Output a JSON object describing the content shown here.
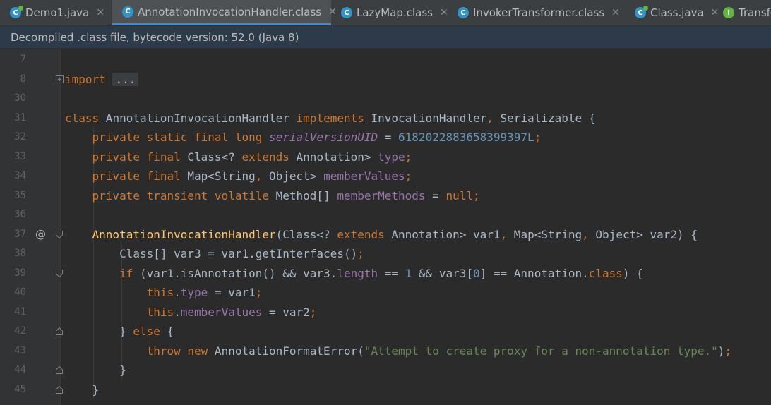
{
  "tabs": [
    {
      "label": "Demo1.java",
      "icon": "java-class-icon",
      "glyph": "C",
      "active": false
    },
    {
      "label": "AnnotationInvocationHandler.class",
      "icon": "class-icon",
      "glyph": "C",
      "active": true
    },
    {
      "label": "LazyMap.class",
      "icon": "class-icon",
      "glyph": "C",
      "active": false
    },
    {
      "label": "InvokerTransformer.class",
      "icon": "class-icon",
      "glyph": "C",
      "active": false
    },
    {
      "label": "Class.java",
      "icon": "java-class-icon",
      "glyph": "C",
      "active": false
    },
    {
      "label": "Transfo",
      "icon": "interface-icon",
      "glyph": "I",
      "active": false
    }
  ],
  "banner": {
    "text": "Decompiled .class file, bytecode version: 52.0 (Java 8)"
  },
  "editor": {
    "lines": [
      {
        "num": "7",
        "segments": []
      },
      {
        "num": "8",
        "fold": "collapsed",
        "segments": [
          {
            "t": "import",
            "c": "kw"
          },
          {
            "t": " "
          },
          {
            "t": "...",
            "c": "fold-box"
          }
        ]
      },
      {
        "num": "30",
        "segments": []
      },
      {
        "num": "31",
        "segments": [
          {
            "t": "class",
            "c": "kw"
          },
          {
            "t": " AnnotationInvocationHandler "
          },
          {
            "t": "implements",
            "c": "kw"
          },
          {
            "t": " InvocationHandler"
          },
          {
            "t": ",",
            "c": "kw"
          },
          {
            "t": " Serializable {"
          }
        ]
      },
      {
        "num": "32",
        "segments": [
          {
            "t": "    "
          },
          {
            "t": "private static final long",
            "c": "kw"
          },
          {
            "t": " "
          },
          {
            "t": "serialVersionUID",
            "c": "sfld"
          },
          {
            "t": " = "
          },
          {
            "t": "6182022883658399397L",
            "c": "num"
          },
          {
            "t": ";",
            "c": "kw"
          }
        ]
      },
      {
        "num": "33",
        "segments": [
          {
            "t": "    "
          },
          {
            "t": "private final",
            "c": "kw"
          },
          {
            "t": " Class<? "
          },
          {
            "t": "extends",
            "c": "kw"
          },
          {
            "t": " Annotation> "
          },
          {
            "t": "type",
            "c": "fld"
          },
          {
            "t": ";",
            "c": "kw"
          }
        ]
      },
      {
        "num": "34",
        "segments": [
          {
            "t": "    "
          },
          {
            "t": "private final",
            "c": "kw"
          },
          {
            "t": " Map<String"
          },
          {
            "t": ",",
            "c": "kw"
          },
          {
            "t": " Object> "
          },
          {
            "t": "memberValues",
            "c": "fld"
          },
          {
            "t": ";",
            "c": "kw"
          }
        ]
      },
      {
        "num": "35",
        "segments": [
          {
            "t": "    "
          },
          {
            "t": "private transient volatile",
            "c": "kw"
          },
          {
            "t": " Method[] "
          },
          {
            "t": "memberMethods",
            "c": "fld"
          },
          {
            "t": " = "
          },
          {
            "t": "null",
            "c": "kw"
          },
          {
            "t": ";",
            "c": "kw"
          }
        ]
      },
      {
        "num": "36",
        "segments": []
      },
      {
        "num": "37",
        "mark": "@",
        "fold": "open",
        "segments": [
          {
            "t": "    "
          },
          {
            "t": "AnnotationInvocationHandler",
            "c": "fn"
          },
          {
            "t": "(Class<? "
          },
          {
            "t": "extends",
            "c": "kw"
          },
          {
            "t": " Annotation> var1"
          },
          {
            "t": ",",
            "c": "kw"
          },
          {
            "t": " Map<String"
          },
          {
            "t": ",",
            "c": "kw"
          },
          {
            "t": " Object> var2) {"
          }
        ]
      },
      {
        "num": "38",
        "segments": [
          {
            "t": "        Class[] var3 = var1.getInterfaces()"
          },
          {
            "t": ";",
            "c": "kw"
          }
        ]
      },
      {
        "num": "39",
        "fold": "open",
        "segments": [
          {
            "t": "        "
          },
          {
            "t": "if",
            "c": "kw"
          },
          {
            "t": " (var1.isAnnotation() && var3."
          },
          {
            "t": "length",
            "c": "fld"
          },
          {
            "t": " == "
          },
          {
            "t": "1",
            "c": "num"
          },
          {
            "t": " && var3["
          },
          {
            "t": "0",
            "c": "num"
          },
          {
            "t": "] == Annotation."
          },
          {
            "t": "class",
            "c": "kw"
          },
          {
            "t": ") {"
          }
        ]
      },
      {
        "num": "40",
        "segments": [
          {
            "t": "            "
          },
          {
            "t": "this",
            "c": "kw"
          },
          {
            "t": "."
          },
          {
            "t": "type",
            "c": "fld"
          },
          {
            "t": " = var1"
          },
          {
            "t": ";",
            "c": "kw"
          }
        ]
      },
      {
        "num": "41",
        "segments": [
          {
            "t": "            "
          },
          {
            "t": "this",
            "c": "kw"
          },
          {
            "t": "."
          },
          {
            "t": "memberValues",
            "c": "fld"
          },
          {
            "t": " = var2"
          },
          {
            "t": ";",
            "c": "kw"
          }
        ]
      },
      {
        "num": "42",
        "fold": "close",
        "segments": [
          {
            "t": "        } "
          },
          {
            "t": "else",
            "c": "kw"
          },
          {
            "t": " {"
          }
        ]
      },
      {
        "num": "43",
        "segments": [
          {
            "t": "            "
          },
          {
            "t": "throw new",
            "c": "kw"
          },
          {
            "t": " AnnotationFormatError("
          },
          {
            "t": "\"Attempt to create proxy for a non-annotation type.\"",
            "c": "str"
          },
          {
            "t": ")"
          },
          {
            "t": ";",
            "c": "kw"
          }
        ]
      },
      {
        "num": "44",
        "fold": "close",
        "segments": [
          {
            "t": "        }"
          }
        ]
      },
      {
        "num": "45",
        "fold": "close",
        "segments": [
          {
            "t": "    }"
          }
        ]
      }
    ]
  },
  "colors": {
    "background": "#2b2b2b",
    "keyword": "#cc7832",
    "field": "#9876aa",
    "number": "#6897bb",
    "string": "#6a8759",
    "method": "#ffc66d",
    "accent": "#4a88c7"
  }
}
